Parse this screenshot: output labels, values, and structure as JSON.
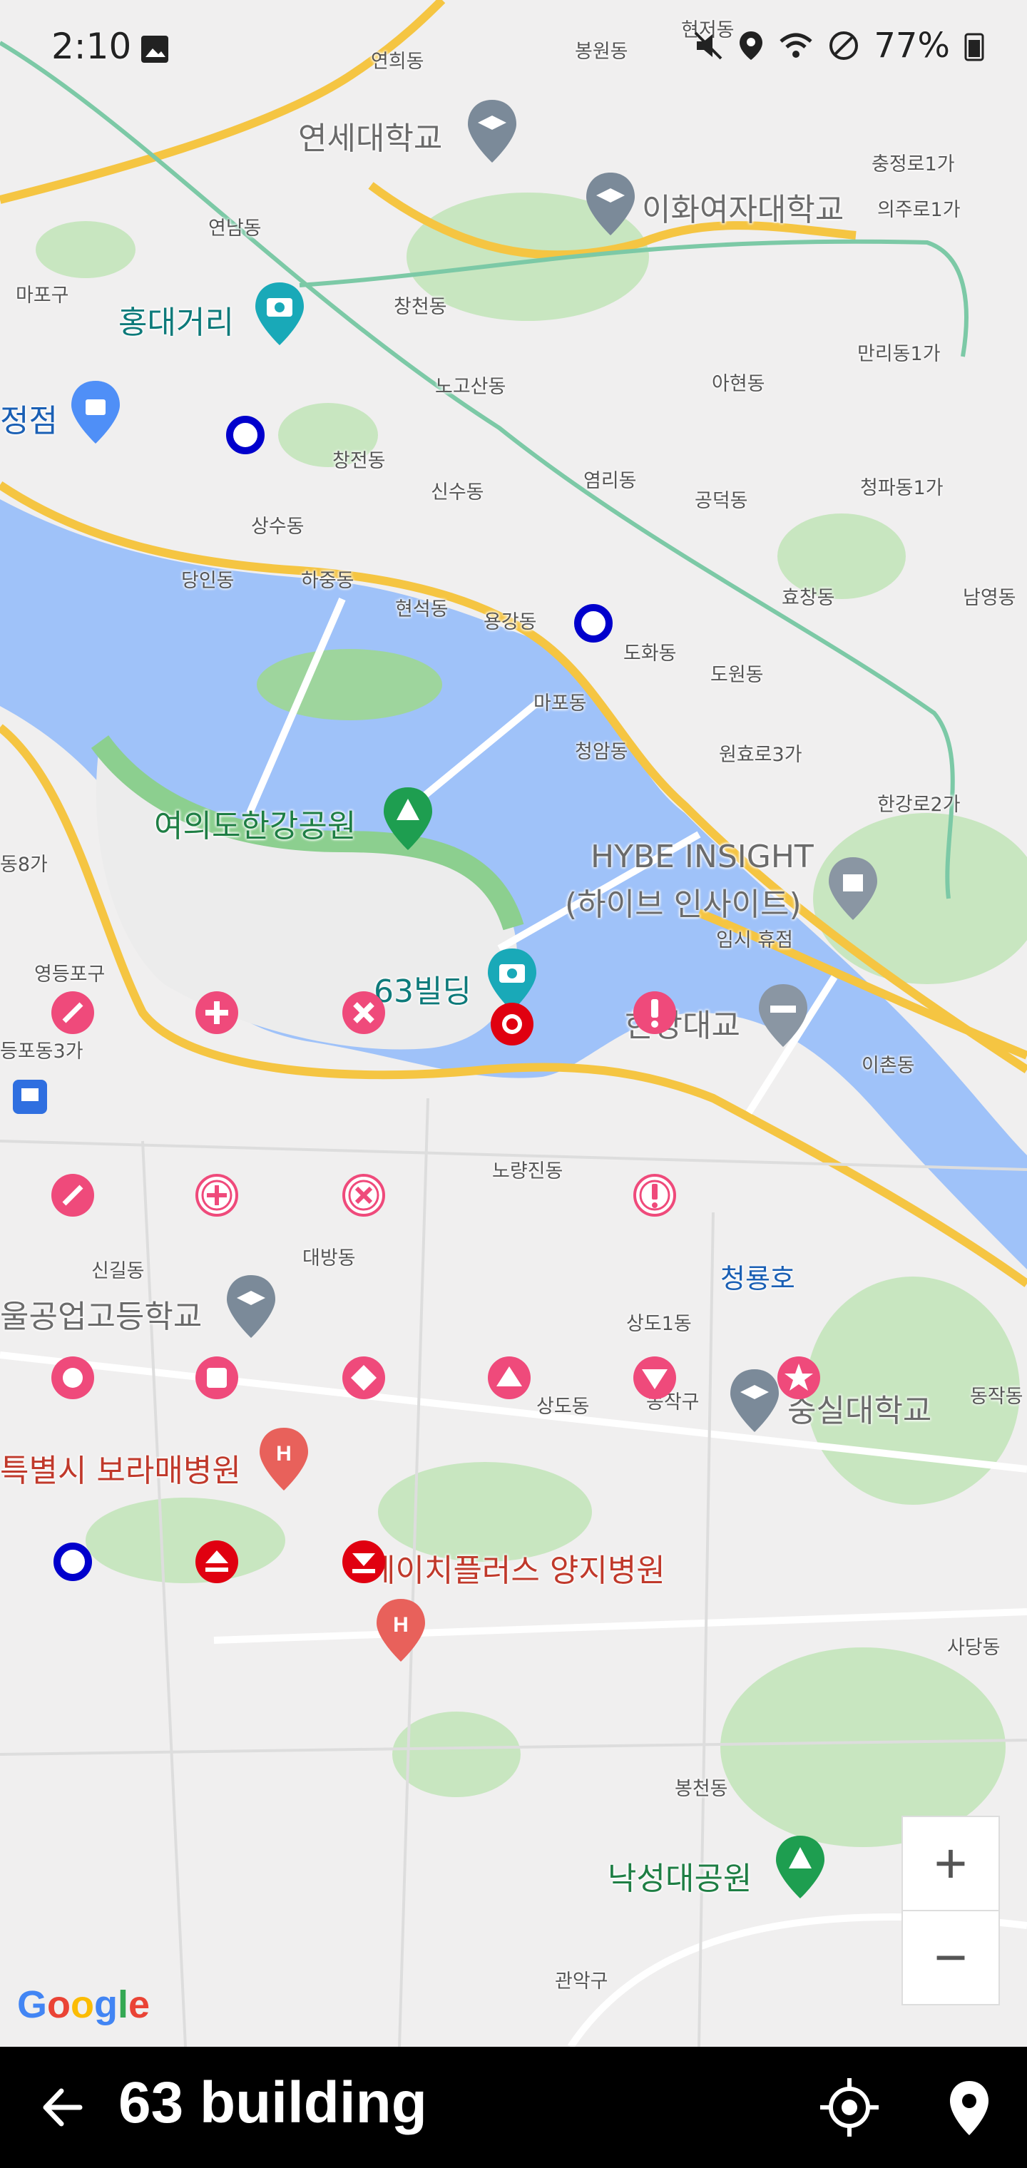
{
  "status_bar": {
    "time": "2:10",
    "battery": "77%",
    "icons": [
      "image-icon",
      "mute-icon",
      "location-icon",
      "wifi-icon",
      "dnd-icon",
      "battery-icon"
    ]
  },
  "map": {
    "labels": {
      "yeonhui": "연희동",
      "bongwon": "봉원동",
      "hyeonjeo": "현저동",
      "yonsei": "연세대학교",
      "ewha": "이화여자대학교",
      "chungjeongno": "충정로1가",
      "uiju": "의주로1가",
      "yeonnam": "연남동",
      "mapogu": "마포구",
      "hongdae": "홍대거리",
      "changcheon": "창천동",
      "noksan": "노고산동",
      "ahyeon": "아현동",
      "malli": "만리동1가",
      "jeongjeom": "정점",
      "changjeon": "창전동",
      "sinsu": "신수동",
      "yeomni": "염리동",
      "gongdeok": "공덕동",
      "cheongpa": "청파동1가",
      "sangsu": "상수동",
      "dangin": "당인동",
      "hajung": "하중동",
      "hyeonseok": "현석동",
      "yonggang": "용강동",
      "dohwa": "도화동",
      "hyochang": "효창동",
      "namyeong": "남영동",
      "dowon": "도원동",
      "mapo": "마포동",
      "cheongam": "청암동",
      "wonhyoro": "원효로3가",
      "yeouido_park": "여의도한강공원",
      "hangang2": "한강로2가",
      "hybe": "HYBE INSIGHT",
      "hybe_kr": "(하이브 인사이트)",
      "temp_closed": "임시 휴점",
      "dong8": "동8가",
      "yeongdeungpo": "영등포구",
      "building63": "63빌딩",
      "hangang_bridge": "한강대교",
      "ichon": "이촌동",
      "yeongdeungpo3": "등포동3가",
      "noryangjin": "노량진동",
      "singil": "신길동",
      "daebang": "대방동",
      "cheongryongho": "청룡호",
      "technical_hs": "울공업고등학교",
      "sangdo1": "상도1동",
      "sangdo": "상도동",
      "dongjak_gu": "동작구",
      "soongsil": "숭실대학교",
      "dongjak": "동작동",
      "boramae": "특별시 보라매병원",
      "yangji": "에이치플러스 양지병원",
      "sadang": "사당동",
      "bongcheon": "봉천동",
      "nakseongdae": "낙성대공원",
      "gwanak": "관악구"
    },
    "markers": [
      {
        "shape": "ring-blue"
      },
      {
        "shape": "ring-blue"
      },
      {
        "shape": "ring-red"
      },
      {
        "shape": "slash-pink"
      },
      {
        "shape": "plus-pink"
      },
      {
        "shape": "x-pink"
      },
      {
        "shape": "exclaim-pink"
      },
      {
        "shape": "slash-pink"
      },
      {
        "shape": "plus-outline"
      },
      {
        "shape": "x-outline"
      },
      {
        "shape": "exclaim-outline"
      },
      {
        "shape": "circle-pink"
      },
      {
        "shape": "square-pink"
      },
      {
        "shape": "diamond-pink"
      },
      {
        "shape": "triangle-up-pink"
      },
      {
        "shape": "triangle-down-pink"
      },
      {
        "shape": "star-pink"
      },
      {
        "shape": "ring-blue"
      },
      {
        "shape": "up-red"
      },
      {
        "shape": "down-red"
      }
    ],
    "attribution": "Google"
  },
  "zoom": {
    "in": "+",
    "out": "−"
  },
  "bottom_bar": {
    "title": "63 building"
  }
}
